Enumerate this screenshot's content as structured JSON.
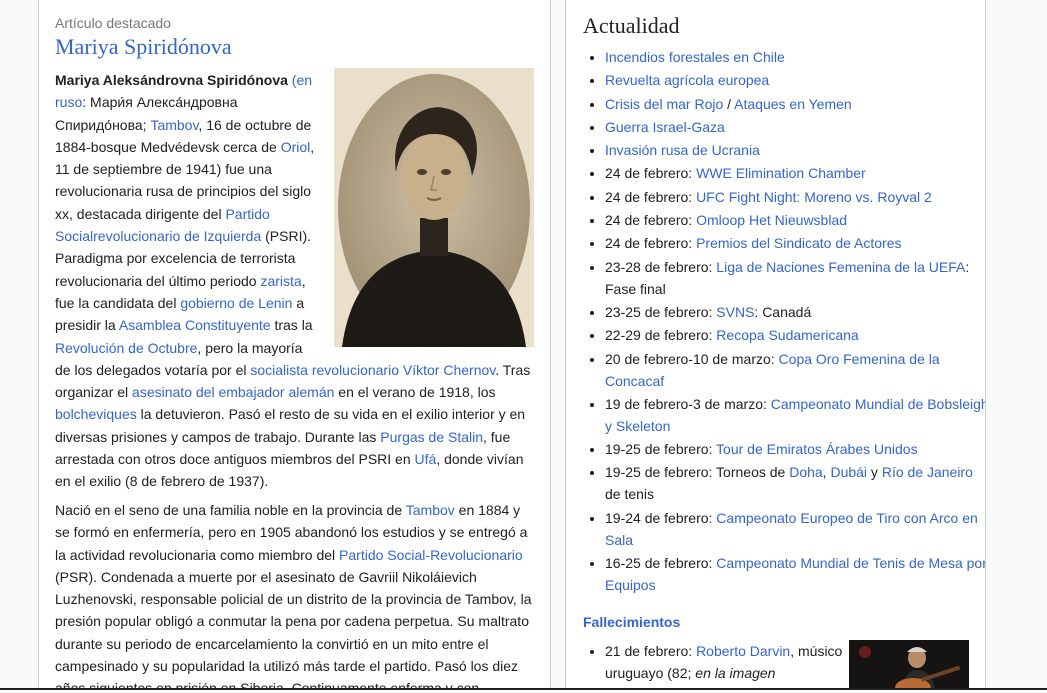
{
  "featured": {
    "kicker": "Artículo destacado",
    "title": "Mariya Spiridónova",
    "image_alt": "Retrato de Mariya Spiridónova",
    "p1": [
      {
        "t": "Mariya Aleksándrovna Spiridónova",
        "b": true
      },
      {
        "t": " "
      },
      {
        "t": "(en ruso",
        "l": true
      },
      {
        "t": ": Мари́я Алекса́ндровна Спиридо́нова; "
      },
      {
        "t": "Tambov",
        "l": true
      },
      {
        "t": ", 16 de octubre de 1884-bosque Medvédevsk cerca de "
      },
      {
        "t": "Oriol",
        "l": true
      },
      {
        "t": ", 11 de septiembre de 1941) fue una revolucionaria rusa de principios del siglo xx, destacada dirigente del "
      },
      {
        "t": "Partido Socialrevolucionario de Izquierda",
        "l": true
      },
      {
        "t": " (PSRI). Paradigma por excelencia de terrorista revolucionaria del último periodo "
      },
      {
        "t": "zarista",
        "l": true
      },
      {
        "t": ", fue la candidata del "
      },
      {
        "t": "gobierno de Lenin",
        "l": true
      },
      {
        "t": " a presidir la "
      },
      {
        "t": "Asamblea Constituyente",
        "l": true
      },
      {
        "t": " tras la "
      },
      {
        "t": "Revolución de Octubre",
        "l": true
      },
      {
        "t": ", pero la mayoría de los delegados votaría por el "
      },
      {
        "t": "socialista revolucionario",
        "l": true
      },
      {
        "t": " "
      },
      {
        "t": "Víktor Chernov",
        "l": true
      },
      {
        "t": ". Tras organizar el "
      },
      {
        "t": "asesinato del embajador alemán",
        "l": true
      },
      {
        "t": " en el verano de 1918, los "
      },
      {
        "t": "bolcheviques",
        "l": true
      },
      {
        "t": " la detuvieron. Pasó el resto de su vida en el exilio interior y en diversas prisiones y campos de trabajo. Durante las "
      },
      {
        "t": "Purgas de Stalin",
        "l": true
      },
      {
        "t": ", fue arrestada con otros doce antiguos miembros del PSRI en "
      },
      {
        "t": "Ufá",
        "l": true
      },
      {
        "t": ", donde vivían en el exilio (8 de febrero de 1937)."
      }
    ],
    "p2": [
      {
        "t": "Nació en el seno de una familia noble en la provincia de "
      },
      {
        "t": "Tambov",
        "l": true
      },
      {
        "t": " en 1884 y se formó en enfermería, pero en 1905 abandonó los estudios y se entregó a la actividad revolucionaria como miembro del "
      },
      {
        "t": "Partido Social-Revolucionario",
        "l": true
      },
      {
        "t": " (PSR). Condenada a muerte por el asesinato de Gavriil Nikoláievich Luzhenovski, responsable policial de un distrito de la provincia de Tambov, la presión popular obligó a conmutar la pena por cadena perpetua. Su maltrato durante su periodo de encarcelamiento la convirtió en un mito entre el campesinado y su popularidad la utilizó más tarde el partido. Pasó los diez años siguientes en prisión en Siberia. Continuamente enferma y con"
      }
    ]
  },
  "news": {
    "title": "Actualidad",
    "items": [
      [
        {
          "t": "Incendios forestales en Chile",
          "l": true
        }
      ],
      [
        {
          "t": "Revuelta agrícola europea",
          "l": true
        }
      ],
      [
        {
          "t": "Crisis del mar Rojo",
          "l": true
        },
        {
          "t": " / "
        },
        {
          "t": "Ataques en Yemen",
          "l": true
        }
      ],
      [
        {
          "t": "Guerra Israel-Gaza",
          "l": true
        }
      ],
      [
        {
          "t": "Invasión rusa de Ucrania",
          "l": true
        }
      ],
      [
        {
          "t": "24 de febrero: "
        },
        {
          "t": "WWE Elimination Chamber",
          "l": true
        }
      ],
      [
        {
          "t": "24 de febrero: "
        },
        {
          "t": "UFC Fight Night: Moreno vs. Royval 2",
          "l": true
        }
      ],
      [
        {
          "t": "24 de febrero: "
        },
        {
          "t": "Omloop Het Nieuwsblad",
          "l": true
        }
      ],
      [
        {
          "t": "24 de febrero: "
        },
        {
          "t": "Premios del Sindicato de Actores",
          "l": true
        }
      ],
      [
        {
          "t": "23-28 de febrero: "
        },
        {
          "t": "Liga de Naciones Femenina de la UEFA",
          "l": true
        },
        {
          "t": ": Fase final"
        }
      ],
      [
        {
          "t": "23-25 de febrero: "
        },
        {
          "t": "SVNS",
          "l": true
        },
        {
          "t": ": Canadá"
        }
      ],
      [
        {
          "t": "22-29 de febrero: "
        },
        {
          "t": "Recopa Sudamericana",
          "l": true
        }
      ],
      [
        {
          "t": "20 de febrero-10 de marzo: "
        },
        {
          "t": "Copa Oro Femenina de la Concacaf",
          "l": true
        }
      ],
      [
        {
          "t": "19 de febrero-3 de marzo: "
        },
        {
          "t": "Campeonato Mundial de Bobsleigh y Skeleton",
          "l": true
        }
      ],
      [
        {
          "t": "19-25 de febrero: "
        },
        {
          "t": "Tour de Emiratos Árabes Unidos",
          "l": true
        }
      ],
      [
        {
          "t": "19-25 de febrero: Torneos de "
        },
        {
          "t": "Doha",
          "l": true
        },
        {
          "t": ", "
        },
        {
          "t": "Dubái",
          "l": true
        },
        {
          "t": " y "
        },
        {
          "t": "Río de Janeiro",
          "l": true
        },
        {
          "t": " de tenis"
        }
      ],
      [
        {
          "t": "19-24 de febrero: "
        },
        {
          "t": "Campeonato Europeo de Tiro con Arco en Sala",
          "l": true
        }
      ],
      [
        {
          "t": "16-25 de febrero: "
        },
        {
          "t": "Campeonato Mundial de Tenis de Mesa por Equipos",
          "l": true
        }
      ]
    ],
    "deaths_title": "Fallecimientos",
    "deaths": [
      [
        {
          "t": "21 de febrero: "
        },
        {
          "t": "Roberto Darvin",
          "l": true
        },
        {
          "t": ", músico uruguayo (82; "
        },
        {
          "t": "en la imagen",
          "i": true
        }
      ]
    ],
    "death_image_alt": "Roberto Darvin con guitarra"
  }
}
